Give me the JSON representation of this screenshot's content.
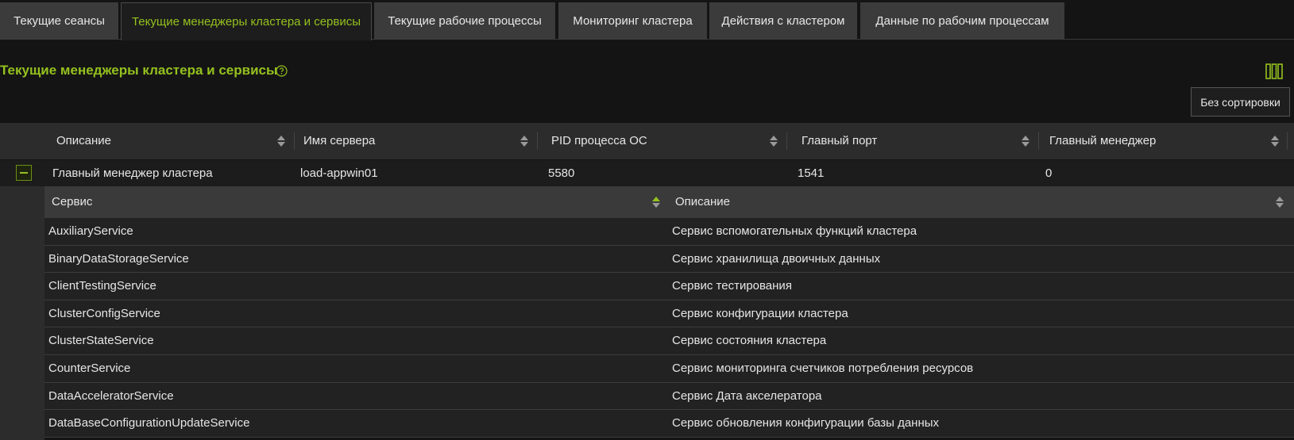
{
  "tabs": [
    {
      "label": "Текущие сеансы",
      "active": false
    },
    {
      "label": "Текущие менеджеры кластера и сервисы",
      "active": true
    },
    {
      "label": "Текущие рабочие процессы",
      "active": false
    },
    {
      "label": "Мониторинг кластера",
      "active": false
    },
    {
      "label": "Действия с кластером",
      "active": false
    },
    {
      "label": "Данные по рабочим процессам",
      "active": false
    }
  ],
  "page": {
    "title": "Текущие менеджеры кластера и сервисы",
    "sort_button": "Без сортировки"
  },
  "grid": {
    "columns": [
      "Описание",
      "Имя сервера",
      "PID процесса ОС",
      "Главный порт",
      "Главный менеджер"
    ],
    "row": {
      "description": "Главный менеджер кластера",
      "server": "load-appwin01",
      "pid": "5580",
      "port": "1541",
      "main_manager": "0"
    }
  },
  "services": {
    "columns": [
      "Сервис",
      "Описание"
    ],
    "sorted_column": "Сервис",
    "rows": [
      {
        "name": "AuxiliaryService",
        "description": "Сервис вспомогательных функций кластера"
      },
      {
        "name": "BinaryDataStorageService",
        "description": "Сервис хранилища двоичных данных"
      },
      {
        "name": "ClientTestingService",
        "description": "Сервис тестирования"
      },
      {
        "name": "ClusterConfigService",
        "description": "Сервис конфигурации кластера"
      },
      {
        "name": "ClusterStateService",
        "description": "Сервис состояния кластера"
      },
      {
        "name": "CounterService",
        "description": "Сервис мониторинга счетчиков потребления ресурсов"
      },
      {
        "name": "DataAcceleratorService",
        "description": "Сервис Дата акселератора"
      },
      {
        "name": "DataBaseConfigurationUpdateService",
        "description": "Сервис обновления конфигурации базы данных"
      }
    ]
  },
  "colors": {
    "accent": "#95c11f",
    "background": "#141414",
    "header": "#2c2c2c"
  }
}
